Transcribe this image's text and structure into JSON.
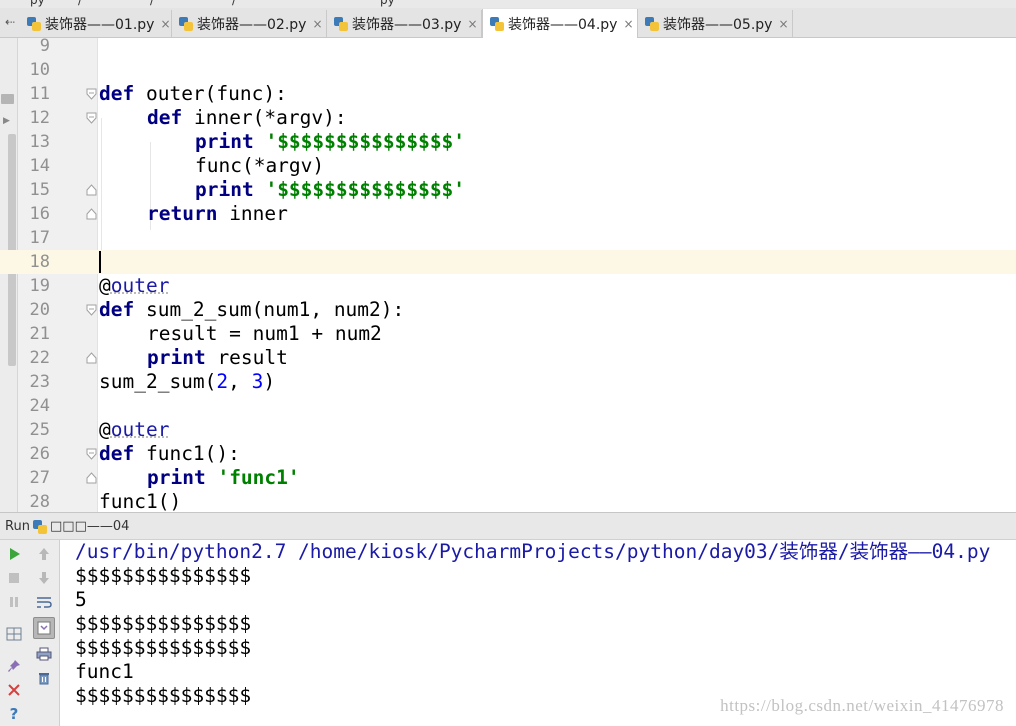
{
  "breadcrumb": {
    "segments": [
      "py",
      "/",
      "/",
      "/",
      "py"
    ]
  },
  "tabs": [
    {
      "label": "装饰器——01.py",
      "close": "×",
      "active": false
    },
    {
      "label": "装饰器——02.py",
      "close": "×",
      "active": false
    },
    {
      "label": "装饰器——03.py",
      "close": "×",
      "active": false
    },
    {
      "label": "装饰器——04.py",
      "close": "×",
      "active": true
    },
    {
      "label": "装饰器——05.py",
      "close": "×",
      "active": false
    }
  ],
  "tab_scroll_glyph": "⇠",
  "editor": {
    "line_numbers": [
      "9",
      "10",
      "11",
      "12",
      "13",
      "14",
      "15",
      "16",
      "17",
      "18",
      "19",
      "20",
      "21",
      "22",
      "23",
      "24",
      "25",
      "26",
      "27",
      "28"
    ],
    "code": {
      "l11_kw": "def",
      "l11_rest": " outer(func):",
      "l12_kw": "def",
      "l12_rest": " inner(*argv):",
      "l13_kw": "print",
      "l13_str": "'$$$$$$$$$$$$$$$'",
      "l14_text": "func(*argv)",
      "l15_kw": "print",
      "l15_str": "'$$$$$$$$$$$$$$$'",
      "l16_kw": "return",
      "l16_rest": " inner",
      "l19_at": "@",
      "l19_name": "outer",
      "l20_kw": "def",
      "l20_rest": " sum_2_sum(num1, num2):",
      "l21_text": "result = num1 + num2",
      "l22_kw": "print",
      "l22_rest": " result",
      "l23_a": "sum_2_sum(",
      "l23_n1": "2",
      "l23_b": ", ",
      "l23_n2": "3",
      "l23_c": ")",
      "l25_at": "@",
      "l25_name": "outer",
      "l26_kw": "def",
      "l26_rest": " func1():",
      "l27_kw": "print",
      "l27_str": "'func1'",
      "l28_text": "func1()"
    }
  },
  "run": {
    "label": "Run",
    "config_name": "□□□——04",
    "output": [
      "/usr/bin/python2.7 /home/kiosk/PycharmProjects/python/day03/装饰器/装饰器——04.py",
      "$$$$$$$$$$$$$$$",
      "5",
      "$$$$$$$$$$$$$$$",
      "$$$$$$$$$$$$$$$",
      "func1",
      "$$$$$$$$$$$$$$$"
    ]
  },
  "watermark": "https://blog.csdn.net/weixin_41476978",
  "icons": {
    "rerun": "play-icon",
    "stop": "stop-icon",
    "pause": "pause-icon",
    "up": "arrow-up-icon",
    "down": "arrow-down-icon",
    "wrap": "soft-wrap-icon",
    "scroll_end": "scroll-to-end-icon",
    "print": "print-icon",
    "trash": "trash-icon",
    "layout": "layout-icon",
    "pin": "pin-icon",
    "close": "close-icon",
    "help": "help-icon"
  },
  "colors": {
    "keyword": "#000080",
    "string": "#008000",
    "number": "#0000ff",
    "caret_line": "#fcf8e5",
    "run_green": "#3ca53c"
  }
}
